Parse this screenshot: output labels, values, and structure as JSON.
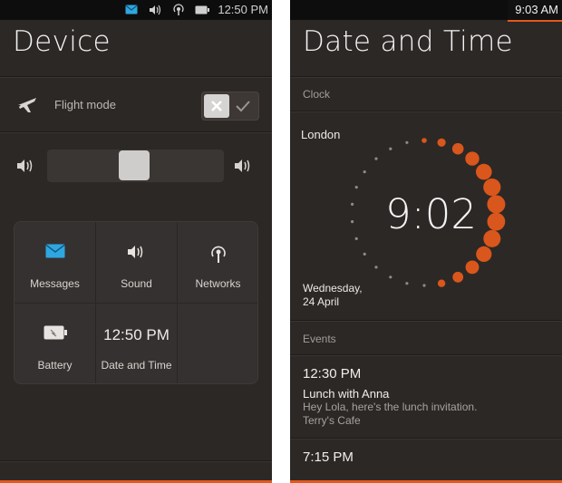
{
  "left_screen": {
    "status": {
      "time": "12:50 PM",
      "icons": [
        "envelope-icon",
        "speaker-icon",
        "network-icon",
        "battery-icon"
      ]
    },
    "title": "Device",
    "flight_mode": {
      "label": "Flight mode",
      "state": "off"
    },
    "volume": {
      "level": 0.5
    },
    "tiles": [
      {
        "label": "Messages",
        "icon": "envelope-icon"
      },
      {
        "label": "Sound",
        "icon": "speaker-icon"
      },
      {
        "label": "Networks",
        "icon": "network-icon"
      },
      {
        "label": "Battery",
        "icon": "battery-icon"
      },
      {
        "label": "Date and Time",
        "display": "12:50 PM"
      }
    ]
  },
  "right_screen": {
    "status": {
      "time": "9:03 AM"
    },
    "title": "Date and Time",
    "clock_section": "Clock",
    "city": "London",
    "clock_time": "9:02",
    "date_line1": "Wednesday,",
    "date_line2": "24 April",
    "events_section": "Events",
    "events": [
      {
        "time": "12:30 PM",
        "title": "Lunch with Anna",
        "desc": "Hey Lola, here's the lunch invitation.",
        "place": "Terry's Cafe"
      },
      {
        "time": "7:15 PM"
      }
    ]
  },
  "colors": {
    "accent": "#e2591b",
    "background": "#2c2826",
    "message_blue": "#2ea6e0"
  }
}
